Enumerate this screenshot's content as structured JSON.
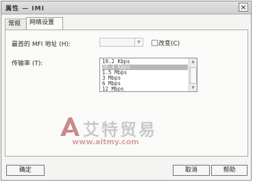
{
  "window": {
    "title": "属性 — IMI"
  },
  "tabs": [
    {
      "label": "常规"
    },
    {
      "label": "网络设置"
    }
  ],
  "fields": {
    "mac_label": "最首的 MFI 地址 (H):",
    "mac_value": "",
    "change_label": "改变(C)",
    "rate_label": "传输率 (T):"
  },
  "rate_options": [
    "19.2 Kbps",
    "38.4 Kbps",
    "1.5 Mbps",
    "3 Mbps",
    "6 Mbps",
    "12 Mbps"
  ],
  "selected_index": 1,
  "watermark": {
    "text": "艾特贸易",
    "url": "www.aitmy.com"
  },
  "buttons": {
    "ok": "确定",
    "cancel": "取消",
    "help": "帮助"
  },
  "colors": {
    "selection": "#b8b8b8",
    "watermark_logo": "#c98a8a"
  }
}
